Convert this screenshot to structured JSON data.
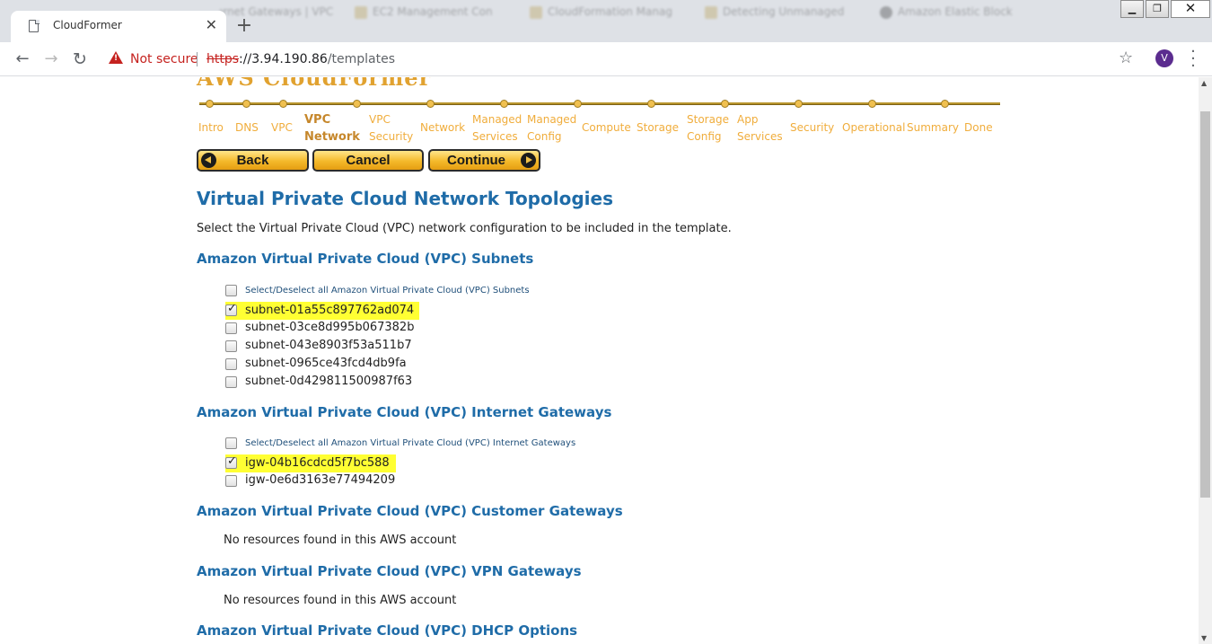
{
  "browser": {
    "tab_title": "CloudFormer",
    "background_tabs": [
      "Internet Gateways | VPC",
      "EC2 Management Con",
      "CloudFormation Manag",
      "Detecting Unmanaged",
      "Amazon Elastic Block"
    ],
    "security_label": "Not secure",
    "url_scheme": "https",
    "url_host": "://3.94.190.86",
    "url_path": "/templates",
    "profile_initial": "V"
  },
  "wizard": {
    "heading_fragment": "AWS CloudFormer",
    "steps": [
      {
        "label": "Intro",
        "current": false
      },
      {
        "label": "DNS",
        "current": false
      },
      {
        "label": "VPC",
        "current": false
      },
      {
        "label": "VPC Network",
        "current": true
      },
      {
        "label": "VPC Security",
        "current": false
      },
      {
        "label": "Network",
        "current": false
      },
      {
        "label": "Managed Services",
        "current": false
      },
      {
        "label": "Managed Config",
        "current": false
      },
      {
        "label": "Compute",
        "current": false
      },
      {
        "label": "Storage",
        "current": false
      },
      {
        "label": "Storage Config",
        "current": false
      },
      {
        "label": "App Services",
        "current": false
      },
      {
        "label": "Security",
        "current": false
      },
      {
        "label": "Operational",
        "current": false
      },
      {
        "label": "Summary",
        "current": false
      },
      {
        "label": "Done",
        "current": false
      }
    ],
    "buttons": {
      "back": "Back",
      "cancel": "Cancel",
      "continue": "Continue"
    }
  },
  "page": {
    "title": "Virtual Private Cloud Network Topologies",
    "intro": "Select the Virtual Private Cloud (VPC) network configuration to be included in the template."
  },
  "subnets": {
    "title": "Amazon Virtual Private Cloud (VPC) Subnets",
    "select_all": "Select/Deselect all Amazon Virtual Private Cloud (VPC) Subnets",
    "items": [
      {
        "id": "subnet-01a55c897762ad074",
        "checked": true
      },
      {
        "id": "subnet-03ce8d995b067382b",
        "checked": false
      },
      {
        "id": "subnet-043e8903f53a511b7",
        "checked": false
      },
      {
        "id": "subnet-0965ce43fcd4db9fa",
        "checked": false
      },
      {
        "id": "subnet-0d429811500987f63",
        "checked": false
      }
    ]
  },
  "igws": {
    "title": "Amazon Virtual Private Cloud (VPC) Internet Gateways",
    "select_all": "Select/Deselect all Amazon Virtual Private Cloud (VPC) Internet Gateways",
    "items": [
      {
        "id": "igw-04b16cdcd5f7bc588",
        "checked": true
      },
      {
        "id": "igw-0e6d3163e77494209",
        "checked": false
      }
    ]
  },
  "cgws": {
    "title": "Amazon Virtual Private Cloud (VPC) Customer Gateways",
    "empty": "No resources found in this AWS account"
  },
  "vpngws": {
    "title": "Amazon Virtual Private Cloud (VPC) VPN Gateways",
    "empty": "No resources found in this AWS account"
  },
  "dhcp": {
    "title": "Amazon Virtual Private Cloud (VPC) DHCP Options"
  }
}
